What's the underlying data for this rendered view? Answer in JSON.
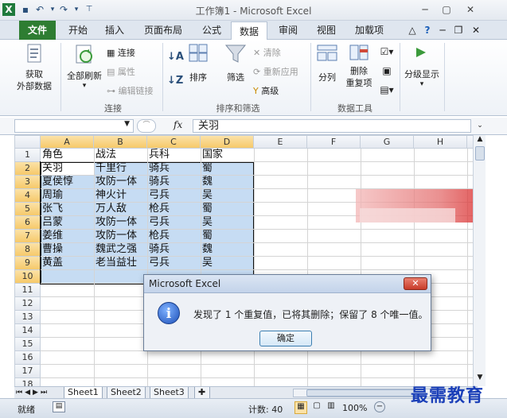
{
  "window": {
    "title": "工作簿1 - Microsoft Excel"
  },
  "tabs": [
    "文件",
    "开始",
    "插入",
    "页面布局",
    "公式",
    "数据",
    "审阅",
    "视图",
    "加载项"
  ],
  "ribbon": {
    "get_external_label": "获取\n外部数据",
    "refresh_all": "全部刷新",
    "connections": "连接",
    "properties": "属性",
    "edit_links": "编辑链接",
    "group_connections": "连接",
    "sort": "排序",
    "filter": "筛选",
    "clear": "清除",
    "reapply": "重新应用",
    "advanced": "高级",
    "group_sort_filter": "排序和筛选",
    "text_to_columns": "分列",
    "remove_duplicates": "删除\n重复项",
    "group_data_tools": "数据工具",
    "outline": "分级显示"
  },
  "formula_bar": {
    "fx": "fx",
    "value": "关羽"
  },
  "columns": [
    "A",
    "B",
    "C",
    "D",
    "E",
    "F",
    "G",
    "H"
  ],
  "rows": [
    "1",
    "2",
    "3",
    "4",
    "5",
    "6",
    "7",
    "8",
    "9",
    "10",
    "11",
    "12",
    "13",
    "14",
    "15",
    "16",
    "17",
    "18"
  ],
  "table": {
    "header": [
      "角色",
      "战法",
      "兵科",
      "国家"
    ],
    "rows": [
      [
        "关羽",
        "千里行",
        "骑兵",
        "蜀"
      ],
      [
        "夏侯惇",
        "攻防一体",
        "骑兵",
        "魏"
      ],
      [
        "周瑜",
        "神火计",
        "弓兵",
        "吴"
      ],
      [
        "张飞",
        "万人敌",
        "枪兵",
        "蜀"
      ],
      [
        "吕蒙",
        "攻防一体",
        "弓兵",
        "吴"
      ],
      [
        "姜维",
        "攻防一体",
        "枪兵",
        "蜀"
      ],
      [
        "曹操",
        "魏武之强",
        "骑兵",
        "魏"
      ],
      [
        "黄盖",
        "老当益壮",
        "弓兵",
        "吴"
      ]
    ]
  },
  "dialog": {
    "title": "Microsoft Excel",
    "message": "发现了 1 个重复值，已将其删除；保留了 8 个唯一值。",
    "ok": "确定",
    "close": "✕"
  },
  "sheet_tabs": [
    "Sheet1",
    "Sheet2",
    "Sheet3"
  ],
  "status": {
    "ready": "就绪",
    "count": "计数: 40",
    "zoom": "100%"
  },
  "watermark": "最需教育"
}
